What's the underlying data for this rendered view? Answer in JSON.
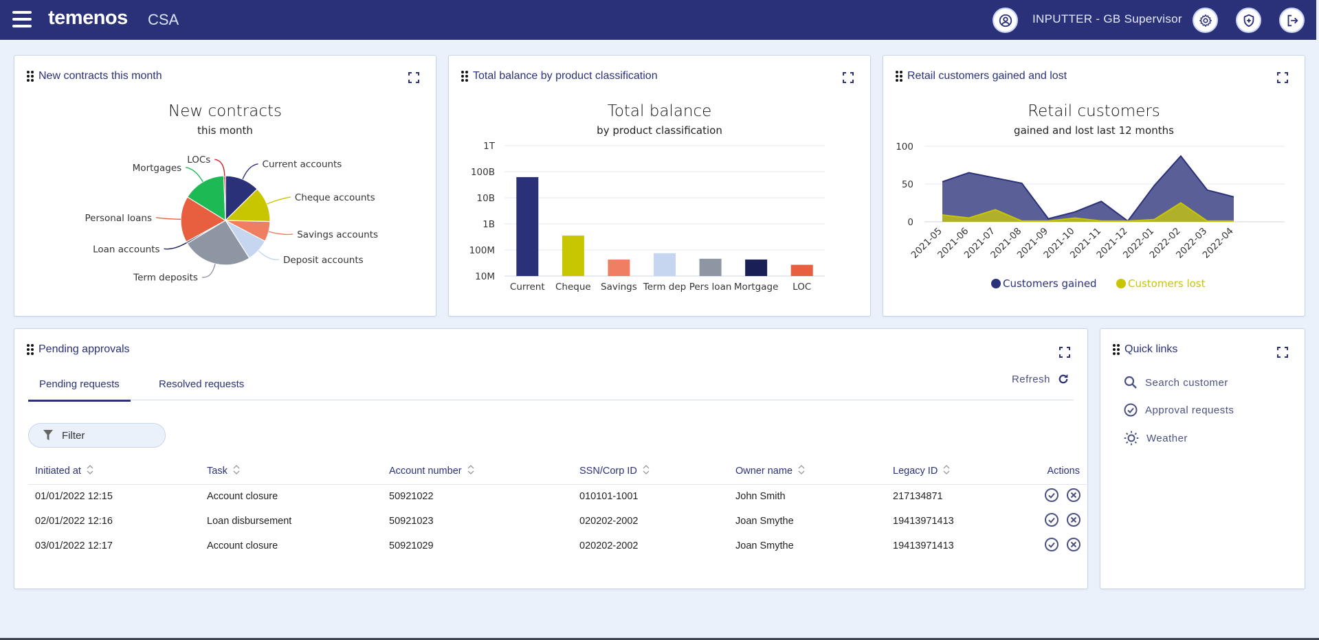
{
  "header": {
    "brand": "temenos",
    "product": "CSA",
    "user_label": "INPUTTER - GB Supervisor",
    "colors": {
      "bar": "#2a3178",
      "background": "#eaf1fb"
    }
  },
  "cards": {
    "new_contracts": {
      "title": "New contracts this month",
      "chart_title": "New contracts",
      "chart_subtitle": "this month"
    },
    "total_balance": {
      "title": "Total balance by product classification",
      "chart_title": "Total balance",
      "chart_subtitle": "by product classification"
    },
    "retail_customers": {
      "title": "Retail customers gained and lost",
      "chart_title": "Retail customers",
      "chart_subtitle": "gained and lost last 12 months"
    }
  },
  "chart_data": [
    {
      "type": "pie",
      "title": "New contracts",
      "subtitle": "this month",
      "unit": "percent",
      "slices": [
        {
          "label": "Current accounts",
          "value": 12.6,
          "color": "#2a3178"
        },
        {
          "label": "Cheque accounts",
          "value": 12.8,
          "color": "#c8c600"
        },
        {
          "label": "Savings accounts",
          "value": 7.3,
          "color": "#ef7f62"
        },
        {
          "label": "Deposit accounts",
          "value": 8.3,
          "color": "#c6d6f0"
        },
        {
          "label": "Term deposits",
          "value": 25.4,
          "color": "#8e95a3"
        },
        {
          "label": "Loan accounts",
          "value": 0.6,
          "color": "#1a1f55"
        },
        {
          "label": "Personal loans",
          "value": 16.8,
          "color": "#e85f3f"
        },
        {
          "label": "Mortgages",
          "value": 15.6,
          "color": "#1db954"
        },
        {
          "label": "LOCs",
          "value": 0.6,
          "color": "#d01e1e"
        }
      ]
    },
    {
      "type": "bar",
      "title": "Total balance",
      "subtitle": "by product classification",
      "yscale": "log",
      "ylim": [
        10000000,
        1000000000000
      ],
      "yticks": [
        {
          "value": 10000000,
          "label": "10M"
        },
        {
          "value": 100000000,
          "label": "100M"
        },
        {
          "value": 1000000000,
          "label": "1B"
        },
        {
          "value": 10000000000,
          "label": "10B"
        },
        {
          "value": 100000000000,
          "label": "100B"
        },
        {
          "value": 1000000000000,
          "label": "1T"
        }
      ],
      "categories": [
        "Current",
        "Cheque",
        "Savings",
        "Term dep",
        "Pers loan",
        "Mortgage",
        "LOC"
      ],
      "values": [
        62000000000,
        355000000,
        43000000,
        75000000,
        46000000,
        43000000,
        27000000
      ],
      "colors": [
        "#2a3178",
        "#c8c600",
        "#ef7f62",
        "#c6d6f0",
        "#8e95a3",
        "#1a1f55",
        "#e85f3f"
      ],
      "grid": true
    },
    {
      "type": "area",
      "title": "Retail customers",
      "subtitle": "gained and lost last 12 months",
      "x": [
        "2021-05",
        "2021-06",
        "2021-07",
        "2021-08",
        "2021-09",
        "2021-10",
        "2021-11",
        "2021-12",
        "2022-01",
        "2022-02",
        "2022-03",
        "2022-04"
      ],
      "ylim": [
        0,
        100
      ],
      "yticks": [
        0,
        50,
        100
      ],
      "series": [
        {
          "name": "Customers gained",
          "values": [
            53,
            65,
            58,
            51,
            4,
            13,
            27,
            1,
            48,
            87,
            42,
            33
          ],
          "color": "#2a3178",
          "fill": "#5a5f98"
        },
        {
          "name": "Customers lost",
          "values": [
            9,
            5,
            16,
            1,
            1,
            5,
            1,
            1,
            3,
            25,
            1,
            1
          ],
          "color": "#c8c600",
          "fill": "#b0b02a"
        }
      ],
      "legend": "bottom",
      "grid": true
    }
  ],
  "pending": {
    "title": "Pending approvals",
    "tabs": [
      {
        "label": "Pending requests",
        "active": true
      },
      {
        "label": "Resolved requests",
        "active": false
      }
    ],
    "refresh_label": "Refresh",
    "filter_label": "Filter",
    "columns": [
      "Initiated at",
      "Task",
      "Account number",
      "SSN/Corp ID",
      "Owner name",
      "Legacy ID",
      "Actions"
    ],
    "rows": [
      [
        "01/01/2022 12:15",
        "Account closure",
        "50921022",
        "010101-1001",
        "John Smith",
        "217134871"
      ],
      [
        "02/01/2022 12:16",
        "Loan disbursement",
        "50921023",
        "020202-2002",
        "Joan Smythe",
        "19413971413"
      ],
      [
        "03/01/2022 12:17",
        "Account closure",
        "50921029",
        "020202-2002",
        "Joan Smythe",
        "19413971413"
      ]
    ]
  },
  "quick_links": {
    "title": "Quick links",
    "items": [
      {
        "label": "Search customer",
        "icon": "search-icon"
      },
      {
        "label": "Approval requests",
        "icon": "check-circle-icon"
      },
      {
        "label": "Weather",
        "icon": "sun-icon"
      }
    ]
  }
}
